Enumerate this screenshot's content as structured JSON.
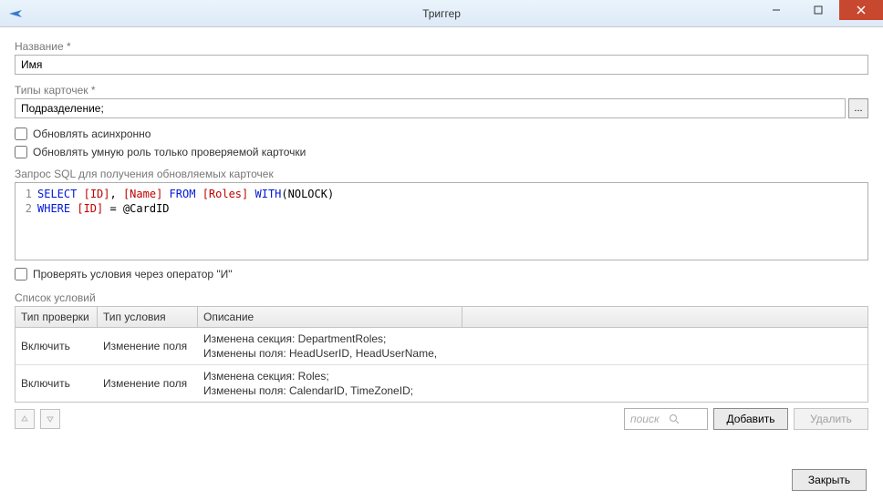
{
  "window": {
    "title": "Триггер"
  },
  "fields": {
    "name_label": "Название  *",
    "name_value": "Имя",
    "cardtypes_label": "Типы карточек  *",
    "cardtypes_value": "Подразделение;",
    "ellipsis": "..."
  },
  "checkboxes": {
    "async_label": "Обновлять асинхронно",
    "smartrole_label": "Обновлять умную роль только проверяемой карточки",
    "and_operator_label": "Проверять условия через оператор \"И\""
  },
  "sql": {
    "label": "Запрос SQL для получения обновляемых карточек",
    "lines": [
      {
        "n": "1",
        "tokens": [
          {
            "t": "SELECT",
            "c": "kw"
          },
          {
            "t": " "
          },
          {
            "t": "[ID]",
            "c": "br"
          },
          {
            "t": ", "
          },
          {
            "t": "[Name]",
            "c": "br"
          },
          {
            "t": " "
          },
          {
            "t": "FROM",
            "c": "kw"
          },
          {
            "t": " "
          },
          {
            "t": "[Roles]",
            "c": "br"
          },
          {
            "t": " "
          },
          {
            "t": "WITH",
            "c": "kw"
          },
          {
            "t": "(NOLOCK)"
          }
        ]
      },
      {
        "n": "2",
        "tokens": [
          {
            "t": "WHERE",
            "c": "kw"
          },
          {
            "t": " "
          },
          {
            "t": "[ID]",
            "c": "br"
          },
          {
            "t": " = @CardID"
          }
        ]
      }
    ]
  },
  "conditions": {
    "label": "Список условий",
    "headers": {
      "check": "Тип проверки",
      "type": "Тип условия",
      "desc": "Описание"
    },
    "rows": [
      {
        "check": "Включить",
        "type": "Изменение поля",
        "desc1": "Изменена секция: DepartmentRoles;",
        "desc2": "Изменены поля: HeadUserID, HeadUserName,"
      },
      {
        "check": "Включить",
        "type": "Изменение поля",
        "desc1": "Изменена секция: Roles;",
        "desc2": "Изменены поля: CalendarID, TimeZoneID;"
      }
    ]
  },
  "toolbar": {
    "search_placeholder": "поиск",
    "add_label": "Добавить",
    "delete_label": "Удалить"
  },
  "footer": {
    "close_label": "Закрыть"
  }
}
